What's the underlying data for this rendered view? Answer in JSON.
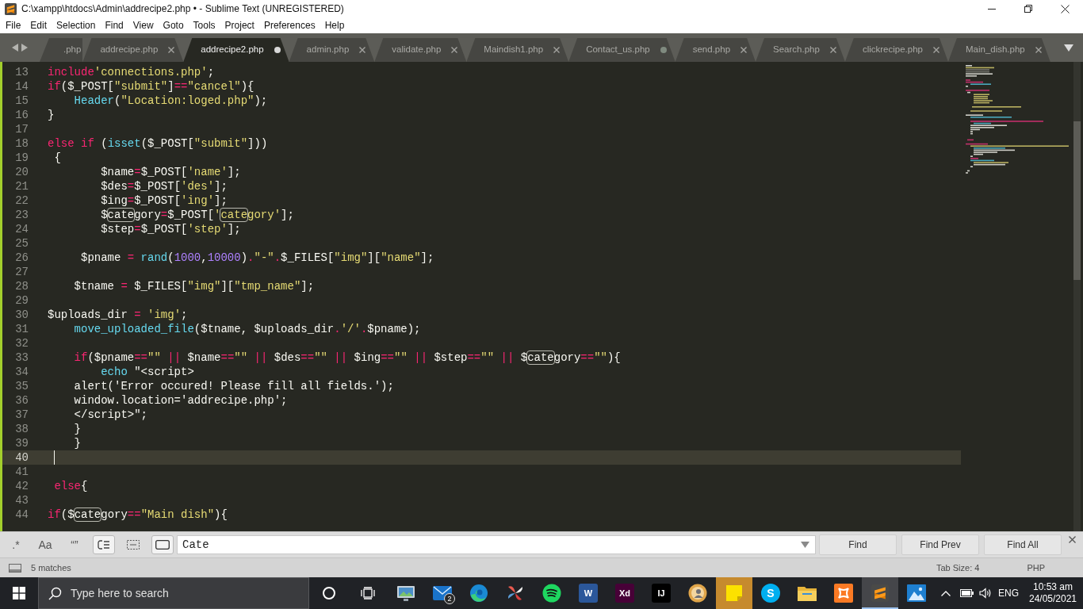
{
  "window": {
    "title": "C:\\xampp\\htdocs\\Admin\\addrecipe2.php • - Sublime Text (UNREGISTERED)"
  },
  "menu": [
    "File",
    "Edit",
    "Selection",
    "Find",
    "View",
    "Goto",
    "Tools",
    "Project",
    "Preferences",
    "Help"
  ],
  "tabs": [
    {
      "kind": "clipped",
      "label": ".php",
      "selected": false
    },
    {
      "kind": "tab",
      "label": "addrecipe.php",
      "selected": false,
      "modified": false
    },
    {
      "kind": "tab",
      "label": "addrecipe2.php",
      "selected": true,
      "modified": true
    },
    {
      "kind": "tab",
      "label": "admin.php",
      "selected": false,
      "modified": false
    },
    {
      "kind": "tab",
      "label": "validate.php",
      "selected": false,
      "modified": false
    },
    {
      "kind": "tab",
      "label": "Maindish1.php",
      "selected": false,
      "modified": false
    },
    {
      "kind": "tab",
      "label": "Contact_us.php",
      "selected": false,
      "modified": true
    },
    {
      "kind": "tab",
      "label": "send.php",
      "selected": false,
      "modified": false
    },
    {
      "kind": "tab",
      "label": "Search.php",
      "selected": false,
      "modified": false
    },
    {
      "kind": "tab",
      "label": "clickrecipe.php",
      "selected": false,
      "modified": false
    },
    {
      "kind": "tab",
      "label": "Main_dish.php",
      "selected": false,
      "modified": false
    }
  ],
  "editor": {
    "lines": [
      {
        "number": "13",
        "current": false,
        "tokens": [
          {
            "kind": "keyword",
            "text": "include"
          },
          {
            "kind": "string",
            "text": "'connections.php'"
          },
          {
            "kind": "plain",
            "text": ";"
          }
        ]
      },
      {
        "number": "14",
        "current": false,
        "tokens": [
          {
            "kind": "keyword",
            "text": "if"
          },
          {
            "kind": "plain",
            "text": "($_POST["
          },
          {
            "kind": "string",
            "text": "\"submit\""
          },
          {
            "kind": "plain",
            "text": "]"
          },
          {
            "kind": "keyword",
            "text": "=="
          },
          {
            "kind": "string",
            "text": "\"cancel\""
          },
          {
            "kind": "plain",
            "text": "){"
          }
        ]
      },
      {
        "number": "15",
        "current": false,
        "tokens": [
          {
            "kind": "function",
            "text": "    Header"
          },
          {
            "kind": "plain",
            "text": "("
          },
          {
            "kind": "string",
            "text": "\"Location:loged.php\""
          },
          {
            "kind": "plain",
            "text": ");"
          }
        ]
      },
      {
        "number": "16",
        "current": false,
        "tokens": [
          {
            "kind": "plain",
            "text": "}"
          }
        ]
      },
      {
        "number": "17",
        "current": false
      },
      {
        "number": "18",
        "current": false,
        "tokens": [
          {
            "kind": "keyword",
            "text": "else if"
          },
          {
            "kind": "plain",
            "text": " ("
          },
          {
            "kind": "function",
            "text": "isset"
          },
          {
            "kind": "plain",
            "text": "($_POST["
          },
          {
            "kind": "string",
            "text": "\"submit\""
          },
          {
            "kind": "plain",
            "text": "]))"
          }
        ]
      },
      {
        "number": "19",
        "current": false,
        "tokens": [
          {
            "kind": "plain",
            "text": " {"
          }
        ]
      },
      {
        "number": "20",
        "current": false,
        "tokens": [
          {
            "kind": "plain",
            "text": "        $name"
          },
          {
            "kind": "keyword",
            "text": "="
          },
          {
            "kind": "plain",
            "text": "$_POST["
          },
          {
            "kind": "string",
            "text": "'name'"
          },
          {
            "kind": "plain",
            "text": "];"
          }
        ]
      },
      {
        "number": "21",
        "current": false,
        "tokens": [
          {
            "kind": "plain",
            "text": "        $des"
          },
          {
            "kind": "keyword",
            "text": "="
          },
          {
            "kind": "plain",
            "text": "$_POST["
          },
          {
            "kind": "string",
            "text": "'des'"
          },
          {
            "kind": "plain",
            "text": "];"
          }
        ]
      },
      {
        "number": "22",
        "current": false,
        "tokens": [
          {
            "kind": "plain",
            "text": "        $ing"
          },
          {
            "kind": "keyword",
            "text": "="
          },
          {
            "kind": "plain",
            "text": "$_POST["
          },
          {
            "kind": "string",
            "text": "'ing'"
          },
          {
            "kind": "plain",
            "text": "];"
          }
        ]
      },
      {
        "number": "23",
        "current": false,
        "tokens": [
          {
            "kind": "plain",
            "text": "        $"
          },
          {
            "kind": "match",
            "text": "cate"
          },
          {
            "kind": "plain",
            "text": "gory"
          },
          {
            "kind": "keyword",
            "text": "="
          },
          {
            "kind": "plain",
            "text": "$_POST["
          },
          {
            "kind": "string",
            "text": "'"
          },
          {
            "kind": "string_match",
            "text": "cate"
          },
          {
            "kind": "string",
            "text": "gory'"
          },
          {
            "kind": "plain",
            "text": "];"
          }
        ]
      },
      {
        "number": "24",
        "current": false,
        "tokens": [
          {
            "kind": "plain",
            "text": "        $step"
          },
          {
            "kind": "keyword",
            "text": "="
          },
          {
            "kind": "plain",
            "text": "$_POST["
          },
          {
            "kind": "string",
            "text": "'step'"
          },
          {
            "kind": "plain",
            "text": "];"
          }
        ]
      },
      {
        "number": "25",
        "current": false
      },
      {
        "number": "26",
        "current": false,
        "tokens": [
          {
            "kind": "plain",
            "text": "     $pname "
          },
          {
            "kind": "keyword",
            "text": "="
          },
          {
            "kind": "function",
            "text": " rand"
          },
          {
            "kind": "plain",
            "text": "("
          },
          {
            "kind": "number",
            "text": "1000"
          },
          {
            "kind": "plain",
            "text": ","
          },
          {
            "kind": "number",
            "text": "10000"
          },
          {
            "kind": "plain",
            "text": ")"
          },
          {
            "kind": "keyword",
            "text": "."
          },
          {
            "kind": "string",
            "text": "\"-\""
          },
          {
            "kind": "keyword",
            "text": "."
          },
          {
            "kind": "plain",
            "text": "$_FILES["
          },
          {
            "kind": "string",
            "text": "\"img\""
          },
          {
            "kind": "plain",
            "text": "]["
          },
          {
            "kind": "string",
            "text": "\"name\""
          },
          {
            "kind": "plain",
            "text": "];"
          }
        ]
      },
      {
        "number": "27",
        "current": false
      },
      {
        "number": "28",
        "current": false,
        "tokens": [
          {
            "kind": "plain",
            "text": "    $tname "
          },
          {
            "kind": "keyword",
            "text": "="
          },
          {
            "kind": "plain",
            "text": " $_FILES["
          },
          {
            "kind": "string",
            "text": "\"img\""
          },
          {
            "kind": "plain",
            "text": "]["
          },
          {
            "kind": "string",
            "text": "\"tmp_name\""
          },
          {
            "kind": "plain",
            "text": "];"
          }
        ]
      },
      {
        "number": "29",
        "current": false
      },
      {
        "number": "30",
        "current": false,
        "tokens": [
          {
            "kind": "plain",
            "text": "$uploads_dir "
          },
          {
            "kind": "keyword",
            "text": "="
          },
          {
            "kind": "string",
            "text": " 'img'"
          },
          {
            "kind": "plain",
            "text": ";"
          }
        ]
      },
      {
        "number": "31",
        "current": false,
        "tokens": [
          {
            "kind": "function",
            "text": "    move_uploaded_file"
          },
          {
            "kind": "plain",
            "text": "($tname, $uploads_dir"
          },
          {
            "kind": "keyword",
            "text": "."
          },
          {
            "kind": "string",
            "text": "'/'"
          },
          {
            "kind": "keyword",
            "text": "."
          },
          {
            "kind": "plain",
            "text": "$pname);"
          }
        ]
      },
      {
        "number": "32",
        "current": false
      },
      {
        "number": "33",
        "current": false,
        "tokens": [
          {
            "kind": "keyword",
            "text": "    if"
          },
          {
            "kind": "plain",
            "text": "($pname"
          },
          {
            "kind": "keyword",
            "text": "=="
          },
          {
            "kind": "string",
            "text": "\"\""
          },
          {
            "kind": "keyword",
            "text": " ||"
          },
          {
            "kind": "plain",
            "text": " $name"
          },
          {
            "kind": "keyword",
            "text": "=="
          },
          {
            "kind": "string",
            "text": "\"\""
          },
          {
            "kind": "keyword",
            "text": " ||"
          },
          {
            "kind": "plain",
            "text": " $des"
          },
          {
            "kind": "keyword",
            "text": "=="
          },
          {
            "kind": "string",
            "text": "\"\""
          },
          {
            "kind": "keyword",
            "text": " ||"
          },
          {
            "kind": "plain",
            "text": " $ing"
          },
          {
            "kind": "keyword",
            "text": "=="
          },
          {
            "kind": "string",
            "text": "\"\""
          },
          {
            "kind": "keyword",
            "text": " ||"
          },
          {
            "kind": "plain",
            "text": " $step"
          },
          {
            "kind": "keyword",
            "text": "=="
          },
          {
            "kind": "string",
            "text": "\"\""
          },
          {
            "kind": "keyword",
            "text": " ||"
          },
          {
            "kind": "plain",
            "text": " $"
          },
          {
            "kind": "match",
            "text": "cate"
          },
          {
            "kind": "plain",
            "text": "gory"
          },
          {
            "kind": "keyword",
            "text": "=="
          },
          {
            "kind": "string",
            "text": "\"\""
          },
          {
            "kind": "plain",
            "text": "){"
          }
        ]
      },
      {
        "number": "34",
        "current": false,
        "tokens": [
          {
            "kind": "function",
            "text": "        echo"
          },
          {
            "kind": "plain",
            "text": " \"<script>"
          }
        ]
      },
      {
        "number": "35",
        "current": false,
        "tokens": [
          {
            "kind": "plain",
            "text": "    alert('Error occured! Please fill all fields.');"
          }
        ]
      },
      {
        "number": "36",
        "current": false,
        "tokens": [
          {
            "kind": "plain",
            "text": "    window.location='addrecipe.php';"
          }
        ]
      },
      {
        "number": "37",
        "current": false,
        "tokens": [
          {
            "kind": "plain",
            "text": "    </script>\";"
          }
        ]
      },
      {
        "number": "38",
        "current": false,
        "tokens": [
          {
            "kind": "plain",
            "text": "    }"
          }
        ]
      },
      {
        "number": "39",
        "current": false,
        "tokens": [
          {
            "kind": "plain",
            "text": "    }"
          }
        ]
      },
      {
        "number": "40",
        "current": true
      },
      {
        "number": "41",
        "current": false
      },
      {
        "number": "42",
        "current": false,
        "tokens": [
          {
            "kind": "keyword",
            "text": " else"
          },
          {
            "kind": "plain",
            "text": "{"
          }
        ]
      },
      {
        "number": "43",
        "current": false
      },
      {
        "number": "44",
        "current": false,
        "tokens": [
          {
            "kind": "keyword",
            "text": "if"
          },
          {
            "kind": "plain",
            "text": "($"
          },
          {
            "kind": "match",
            "text": "cate"
          },
          {
            "kind": "plain",
            "text": "gory"
          },
          {
            "kind": "keyword",
            "text": "=="
          },
          {
            "kind": "string",
            "text": "\"Main dish\""
          },
          {
            "kind": "plain",
            "text": "){"
          }
        ]
      }
    ]
  },
  "find_panel": {
    "toggles": [
      {
        "kind": "text",
        "label": ".*",
        "on": false
      },
      {
        "kind": "text",
        "label": "Aa",
        "on": false
      },
      {
        "kind": "text",
        "label": "“”",
        "on": false
      },
      {
        "kind": "wrap",
        "on": true
      },
      {
        "kind": "in_selection",
        "on": false
      },
      {
        "kind": "highlight",
        "on": true
      }
    ],
    "value": "Cate",
    "buttons": [
      "Find",
      "Find Prev",
      "Find All"
    ]
  },
  "status_bar": {
    "matches": "5 matches",
    "tab_size": "Tab Size: 4",
    "syntax": "PHP"
  },
  "taskbar": {
    "search": {
      "placeholder": "Type here to search"
    },
    "apps": [
      {
        "kind": "image_viewer",
        "active": false,
        "attention": false
      },
      {
        "kind": "mail",
        "badge": "2",
        "active": false,
        "attention": false
      },
      {
        "kind": "browser",
        "active": false,
        "attention": false
      },
      {
        "kind": "pinwheel",
        "active": false,
        "attention": false
      },
      {
        "kind": "music",
        "active": false,
        "attention": false
      },
      {
        "kind": "tile",
        "label": "W",
        "color": "#2b579a",
        "active": false,
        "attention": false
      },
      {
        "kind": "tile",
        "label": "Xd",
        "color": "#470137",
        "active": false,
        "attention": false
      },
      {
        "kind": "tile",
        "label": "IJ",
        "color": "#000000",
        "active": false,
        "attention": false
      },
      {
        "kind": "user_circle",
        "active": false,
        "attention": false
      },
      {
        "kind": "notes",
        "active": false,
        "attention": true
      },
      {
        "kind": "round_tile",
        "label": "S",
        "color": "#00aff0",
        "active": false,
        "attention": false
      },
      {
        "kind": "folder",
        "active": false,
        "attention": false
      },
      {
        "kind": "cross_tile",
        "active": false,
        "attention": false
      },
      {
        "kind": "stripes_logo",
        "active": true,
        "attention": false
      },
      {
        "kind": "landscape",
        "active": false,
        "attention": false
      }
    ],
    "tray": {
      "language": "ENG",
      "time": "10:53 am",
      "date": "24/05/2021"
    }
  }
}
